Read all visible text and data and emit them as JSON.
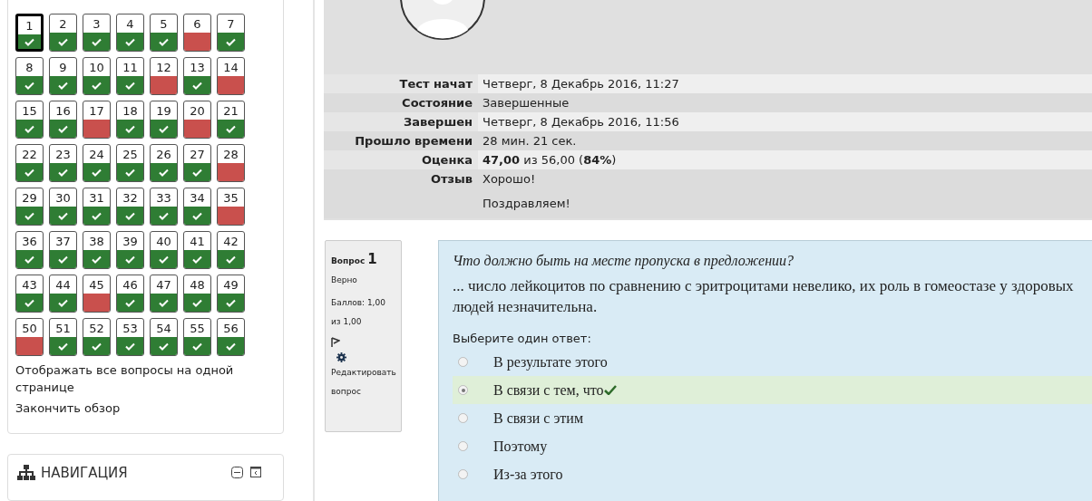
{
  "quiz_navigation": {
    "questions": [
      {
        "number": "1",
        "correct": true,
        "current": true
      },
      {
        "number": "2",
        "correct": true,
        "current": false
      },
      {
        "number": "3",
        "correct": true,
        "current": false
      },
      {
        "number": "4",
        "correct": true,
        "current": false
      },
      {
        "number": "5",
        "correct": true,
        "current": false
      },
      {
        "number": "6",
        "correct": false,
        "current": false
      },
      {
        "number": "7",
        "correct": true,
        "current": false
      },
      {
        "number": "8",
        "correct": true,
        "current": false
      },
      {
        "number": "9",
        "correct": true,
        "current": false
      },
      {
        "number": "10",
        "correct": true,
        "current": false
      },
      {
        "number": "11",
        "correct": true,
        "current": false
      },
      {
        "number": "12",
        "correct": false,
        "current": false
      },
      {
        "number": "13",
        "correct": true,
        "current": false
      },
      {
        "number": "14",
        "correct": false,
        "current": false
      },
      {
        "number": "15",
        "correct": true,
        "current": false
      },
      {
        "number": "16",
        "correct": true,
        "current": false
      },
      {
        "number": "17",
        "correct": false,
        "current": false
      },
      {
        "number": "18",
        "correct": true,
        "current": false
      },
      {
        "number": "19",
        "correct": true,
        "current": false
      },
      {
        "number": "20",
        "correct": false,
        "current": false
      },
      {
        "number": "21",
        "correct": true,
        "current": false
      },
      {
        "number": "22",
        "correct": true,
        "current": false
      },
      {
        "number": "23",
        "correct": true,
        "current": false
      },
      {
        "number": "24",
        "correct": true,
        "current": false
      },
      {
        "number": "25",
        "correct": true,
        "current": false
      },
      {
        "number": "26",
        "correct": true,
        "current": false
      },
      {
        "number": "27",
        "correct": true,
        "current": false
      },
      {
        "number": "28",
        "correct": false,
        "current": false
      },
      {
        "number": "29",
        "correct": true,
        "current": false
      },
      {
        "number": "30",
        "correct": true,
        "current": false
      },
      {
        "number": "31",
        "correct": true,
        "current": false
      },
      {
        "number": "32",
        "correct": true,
        "current": false
      },
      {
        "number": "33",
        "correct": true,
        "current": false
      },
      {
        "number": "34",
        "correct": true,
        "current": false
      },
      {
        "number": "35",
        "correct": false,
        "current": false
      },
      {
        "number": "36",
        "correct": true,
        "current": false
      },
      {
        "number": "37",
        "correct": true,
        "current": false
      },
      {
        "number": "38",
        "correct": true,
        "current": false
      },
      {
        "number": "39",
        "correct": true,
        "current": false
      },
      {
        "number": "40",
        "correct": true,
        "current": false
      },
      {
        "number": "41",
        "correct": true,
        "current": false
      },
      {
        "number": "42",
        "correct": true,
        "current": false
      },
      {
        "number": "43",
        "correct": true,
        "current": false
      },
      {
        "number": "44",
        "correct": true,
        "current": false
      },
      {
        "number": "45",
        "correct": false,
        "current": false
      },
      {
        "number": "46",
        "correct": true,
        "current": false
      },
      {
        "number": "47",
        "correct": true,
        "current": false
      },
      {
        "number": "48",
        "correct": true,
        "current": false
      },
      {
        "number": "49",
        "correct": true,
        "current": false
      },
      {
        "number": "50",
        "correct": false,
        "current": false
      },
      {
        "number": "51",
        "correct": true,
        "current": false
      },
      {
        "number": "52",
        "correct": true,
        "current": false
      },
      {
        "number": "53",
        "correct": true,
        "current": false
      },
      {
        "number": "54",
        "correct": true,
        "current": false
      },
      {
        "number": "55",
        "correct": true,
        "current": false
      },
      {
        "number": "56",
        "correct": true,
        "current": false
      }
    ],
    "links": [
      "Отображать все вопросы на одной странице",
      "Закончить обзор"
    ]
  },
  "navigation_block": {
    "title": "НАВИГАЦИЯ"
  },
  "summary": {
    "rows": [
      {
        "label": "Тест начат",
        "values": [
          "Четверг, 8 Декабрь 2016, 11:27"
        ]
      },
      {
        "label": "Состояние",
        "values": [
          "Завершенные"
        ]
      },
      {
        "label": "Завершен",
        "values": [
          "Четверг, 8 Декабрь 2016, 11:56"
        ]
      },
      {
        "label": "Прошло времени",
        "values": [
          "28 мин. 21 сек."
        ]
      },
      {
        "label": "Оценка",
        "values": [
          "**47,00** из 56,00 (**84%**)"
        ]
      },
      {
        "label": "Отзыв",
        "values": [
          "Хорошо!",
          "Поздравляем!"
        ]
      }
    ]
  },
  "question": {
    "info": {
      "title": "Вопрос",
      "number": "1",
      "state": "Верно",
      "grade": "Баллов: 1,00 из 1,00",
      "edit_link": "Редактировать вопрос"
    },
    "prompt": "Что должно быть на месте пропуска в предложении?",
    "text": "... число лейкоцитов по сравнению с эритроцитами невелико, их роль в гомеостазе у здоровых людей незначительна.",
    "answer_prompt": "Выберите один ответ:",
    "answers": [
      {
        "label": "В результате этого",
        "selected": false,
        "correct": false
      },
      {
        "label": "В связи с тем, что",
        "selected": true,
        "correct": true
      },
      {
        "label": "В связи с этим",
        "selected": false,
        "correct": false
      },
      {
        "label": "Поэтому",
        "selected": false,
        "correct": false
      },
      {
        "label": "Из-за этого",
        "selected": false,
        "correct": false
      }
    ]
  }
}
